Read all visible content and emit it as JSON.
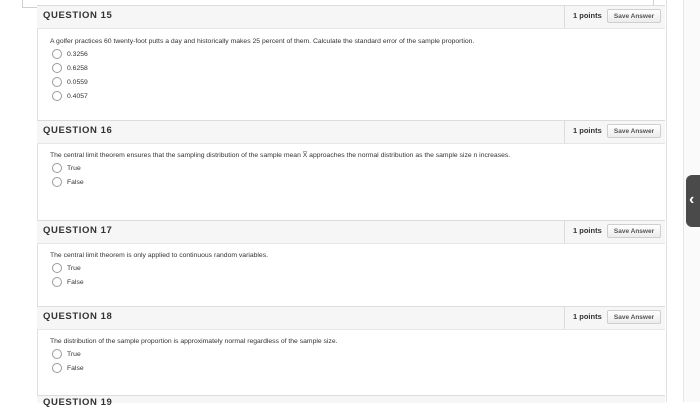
{
  "questions": [
    {
      "title": "QUESTION 15",
      "points": "1 points",
      "save_label": "Save Answer",
      "text": "A golfer practices 60 twenty-foot putts a day and historically makes 25 percent of them. Calculate the standard error of the sample proportion.",
      "options": [
        "0.3256",
        "0.6258",
        "0.0559",
        "0.4057"
      ]
    },
    {
      "title": "QUESTION 16",
      "points": "1 points",
      "save_label": "Save Answer",
      "text": "The central limit theorem ensures that the sampling distribution of the sample mean X̅ approaches the normal distribution as the sample size n increases.",
      "options": [
        "True",
        "False"
      ]
    },
    {
      "title": "QUESTION 17",
      "points": "1 points",
      "save_label": "Save Answer",
      "text": "The central limit theorem is only applied to continuous random variables.",
      "options": [
        "True",
        "False"
      ]
    },
    {
      "title": "QUESTION 18",
      "points": "1 points",
      "save_label": "Save Answer",
      "text": "The distribution of the sample proportion is approximately normal regardless of the sample size.",
      "options": [
        "True",
        "False"
      ]
    }
  ],
  "next_question_partial": "QUESTION 19",
  "side_tab_icon": "chevron-left-icon"
}
